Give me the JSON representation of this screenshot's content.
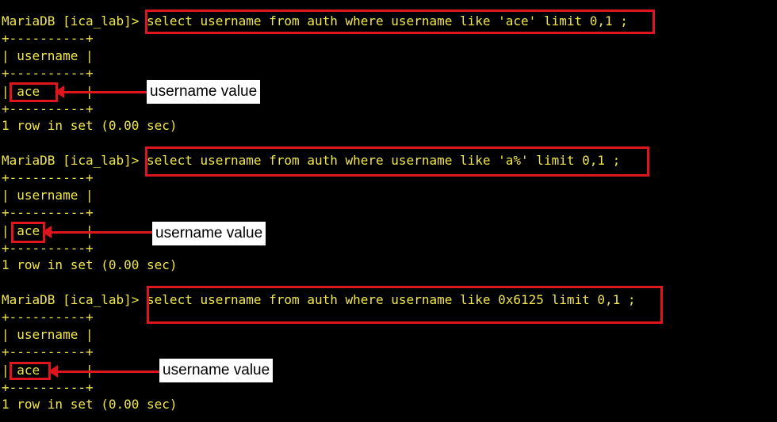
{
  "theme": {
    "background": "#000000",
    "text": "#f0e64a",
    "highlight": "#e0141c",
    "label_bg": "#ffffff"
  },
  "blocks": [
    {
      "prompt": "MariaDB [ica_lab]>",
      "command": "select username from auth where username like 'ace' limit 0,1 ;",
      "border": "+----------+",
      "header": "| username |",
      "value_left": "|",
      "value": "ace",
      "value_right": "|",
      "result": "1 row in set (0.00 sec)",
      "annotation": "username value"
    },
    {
      "prompt": "MariaDB [ica_lab]>",
      "command": "select username from auth where username like 'a%' limit 0,1 ;",
      "border": "+----------+",
      "header": "| username |",
      "value_left": "|",
      "value": "ace",
      "value_right": "|",
      "result": "1 row in set (0.00 sec)",
      "annotation": "username value"
    },
    {
      "prompt": "MariaDB [ica_lab]>",
      "command": "select username from auth where username like 0x6125 limit 0,1 ;",
      "border": "+----------+",
      "header": "| username |",
      "value_left": "|",
      "value": "ace",
      "value_right": "|",
      "result": "1 row in set (0.00 sec)",
      "annotation": "username value"
    }
  ]
}
